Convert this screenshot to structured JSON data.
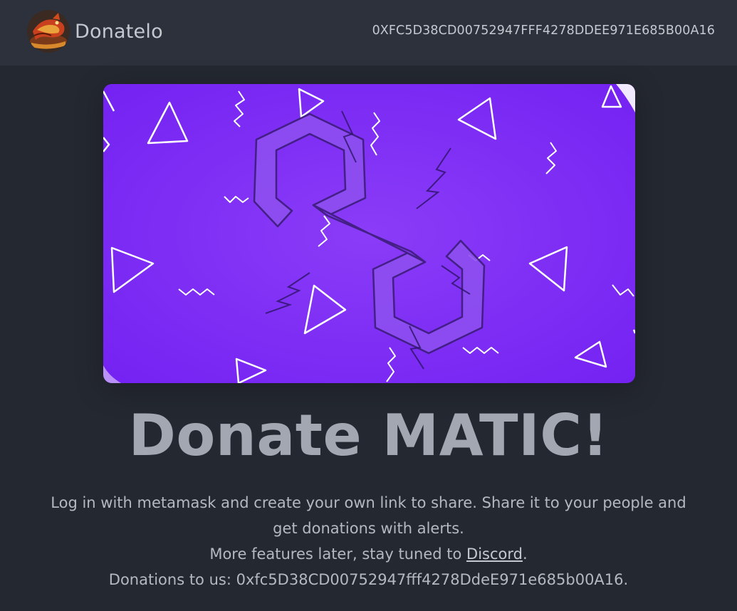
{
  "navbar": {
    "brand_name": "Donatelo",
    "logo_icon": "dragon-avatar-icon",
    "wallet_address": "0XFC5D38CD00752947FFF4278DDEE971E685B00A16"
  },
  "banner": {
    "icon": "polygon-matic-logo-icon",
    "background_color": "#7e2cf6"
  },
  "main": {
    "headline": "Donate MATIC!",
    "description_line1": "Log in with metamask and create your own link to share. Share it to your people and get donations with alerts.",
    "description_line2_prefix": "More features later, stay tuned to ",
    "discord_link": "Discord",
    "description_line2_suffix": ".",
    "donation_prefix": "Donations to us: ",
    "donation_address": "0xfc5D38CD00752947fff4278DdeE971e685b00A16",
    "donation_suffix": "."
  },
  "colors": {
    "page_background": "#242831",
    "navbar_background": "#2c313b",
    "text": "#b4b9c1",
    "headline": "#a2a7b1",
    "accent_purple": "#7e2cf6"
  }
}
